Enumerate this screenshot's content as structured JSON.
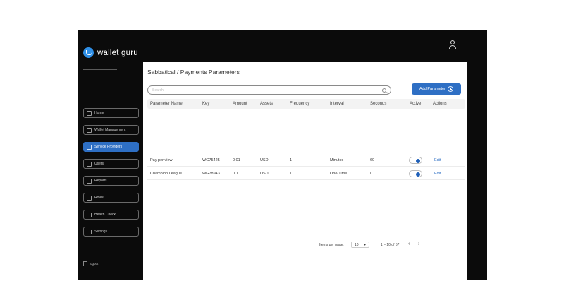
{
  "app": {
    "brand": "wallet guru"
  },
  "sidebar": {
    "items": [
      {
        "label": "Home",
        "active": false
      },
      {
        "label": "Wallet Management",
        "active": false
      },
      {
        "label": "Service Providers",
        "active": true
      },
      {
        "label": "Users",
        "active": false
      },
      {
        "label": "Reports",
        "active": false
      },
      {
        "label": "Roles",
        "active": false
      },
      {
        "label": "Health Check",
        "active": false
      },
      {
        "label": "Settings",
        "active": false
      }
    ],
    "logout": "logout"
  },
  "colors": {
    "accent": "#2e6fc4",
    "sidebar_bg": "#0b0b0b",
    "header_bg": "#f3f3f3"
  },
  "header": {
    "breadcrumb": "Sabbatical / Payments  Parameters"
  },
  "search": {
    "placeholder": "Search"
  },
  "toolbar": {
    "add_label": "Add Parameter"
  },
  "table": {
    "columns": [
      "Parameter Name",
      "Key",
      "Amount",
      "Assets",
      "Frequency",
      "Interval",
      "Seconds",
      "Active",
      "Actions"
    ],
    "rows": [
      {
        "name": "Pay per view",
        "key": "WG75425",
        "amount": "0.01",
        "assets": "USD",
        "frequency": "1",
        "interval": "Minutes",
        "seconds": "60",
        "active": true,
        "action": "Edit"
      },
      {
        "name": "Champion League",
        "key": "WG78943",
        "amount": "0.1",
        "assets": "USD",
        "frequency": "1",
        "interval": "One-Time",
        "seconds": "0",
        "active": true,
        "action": "Edit"
      }
    ]
  },
  "pagination": {
    "items_per_page_label": "Items per page:",
    "items_per_page": "10",
    "range": "1 – 10 of 57",
    "prev": "‹",
    "next": "›"
  }
}
